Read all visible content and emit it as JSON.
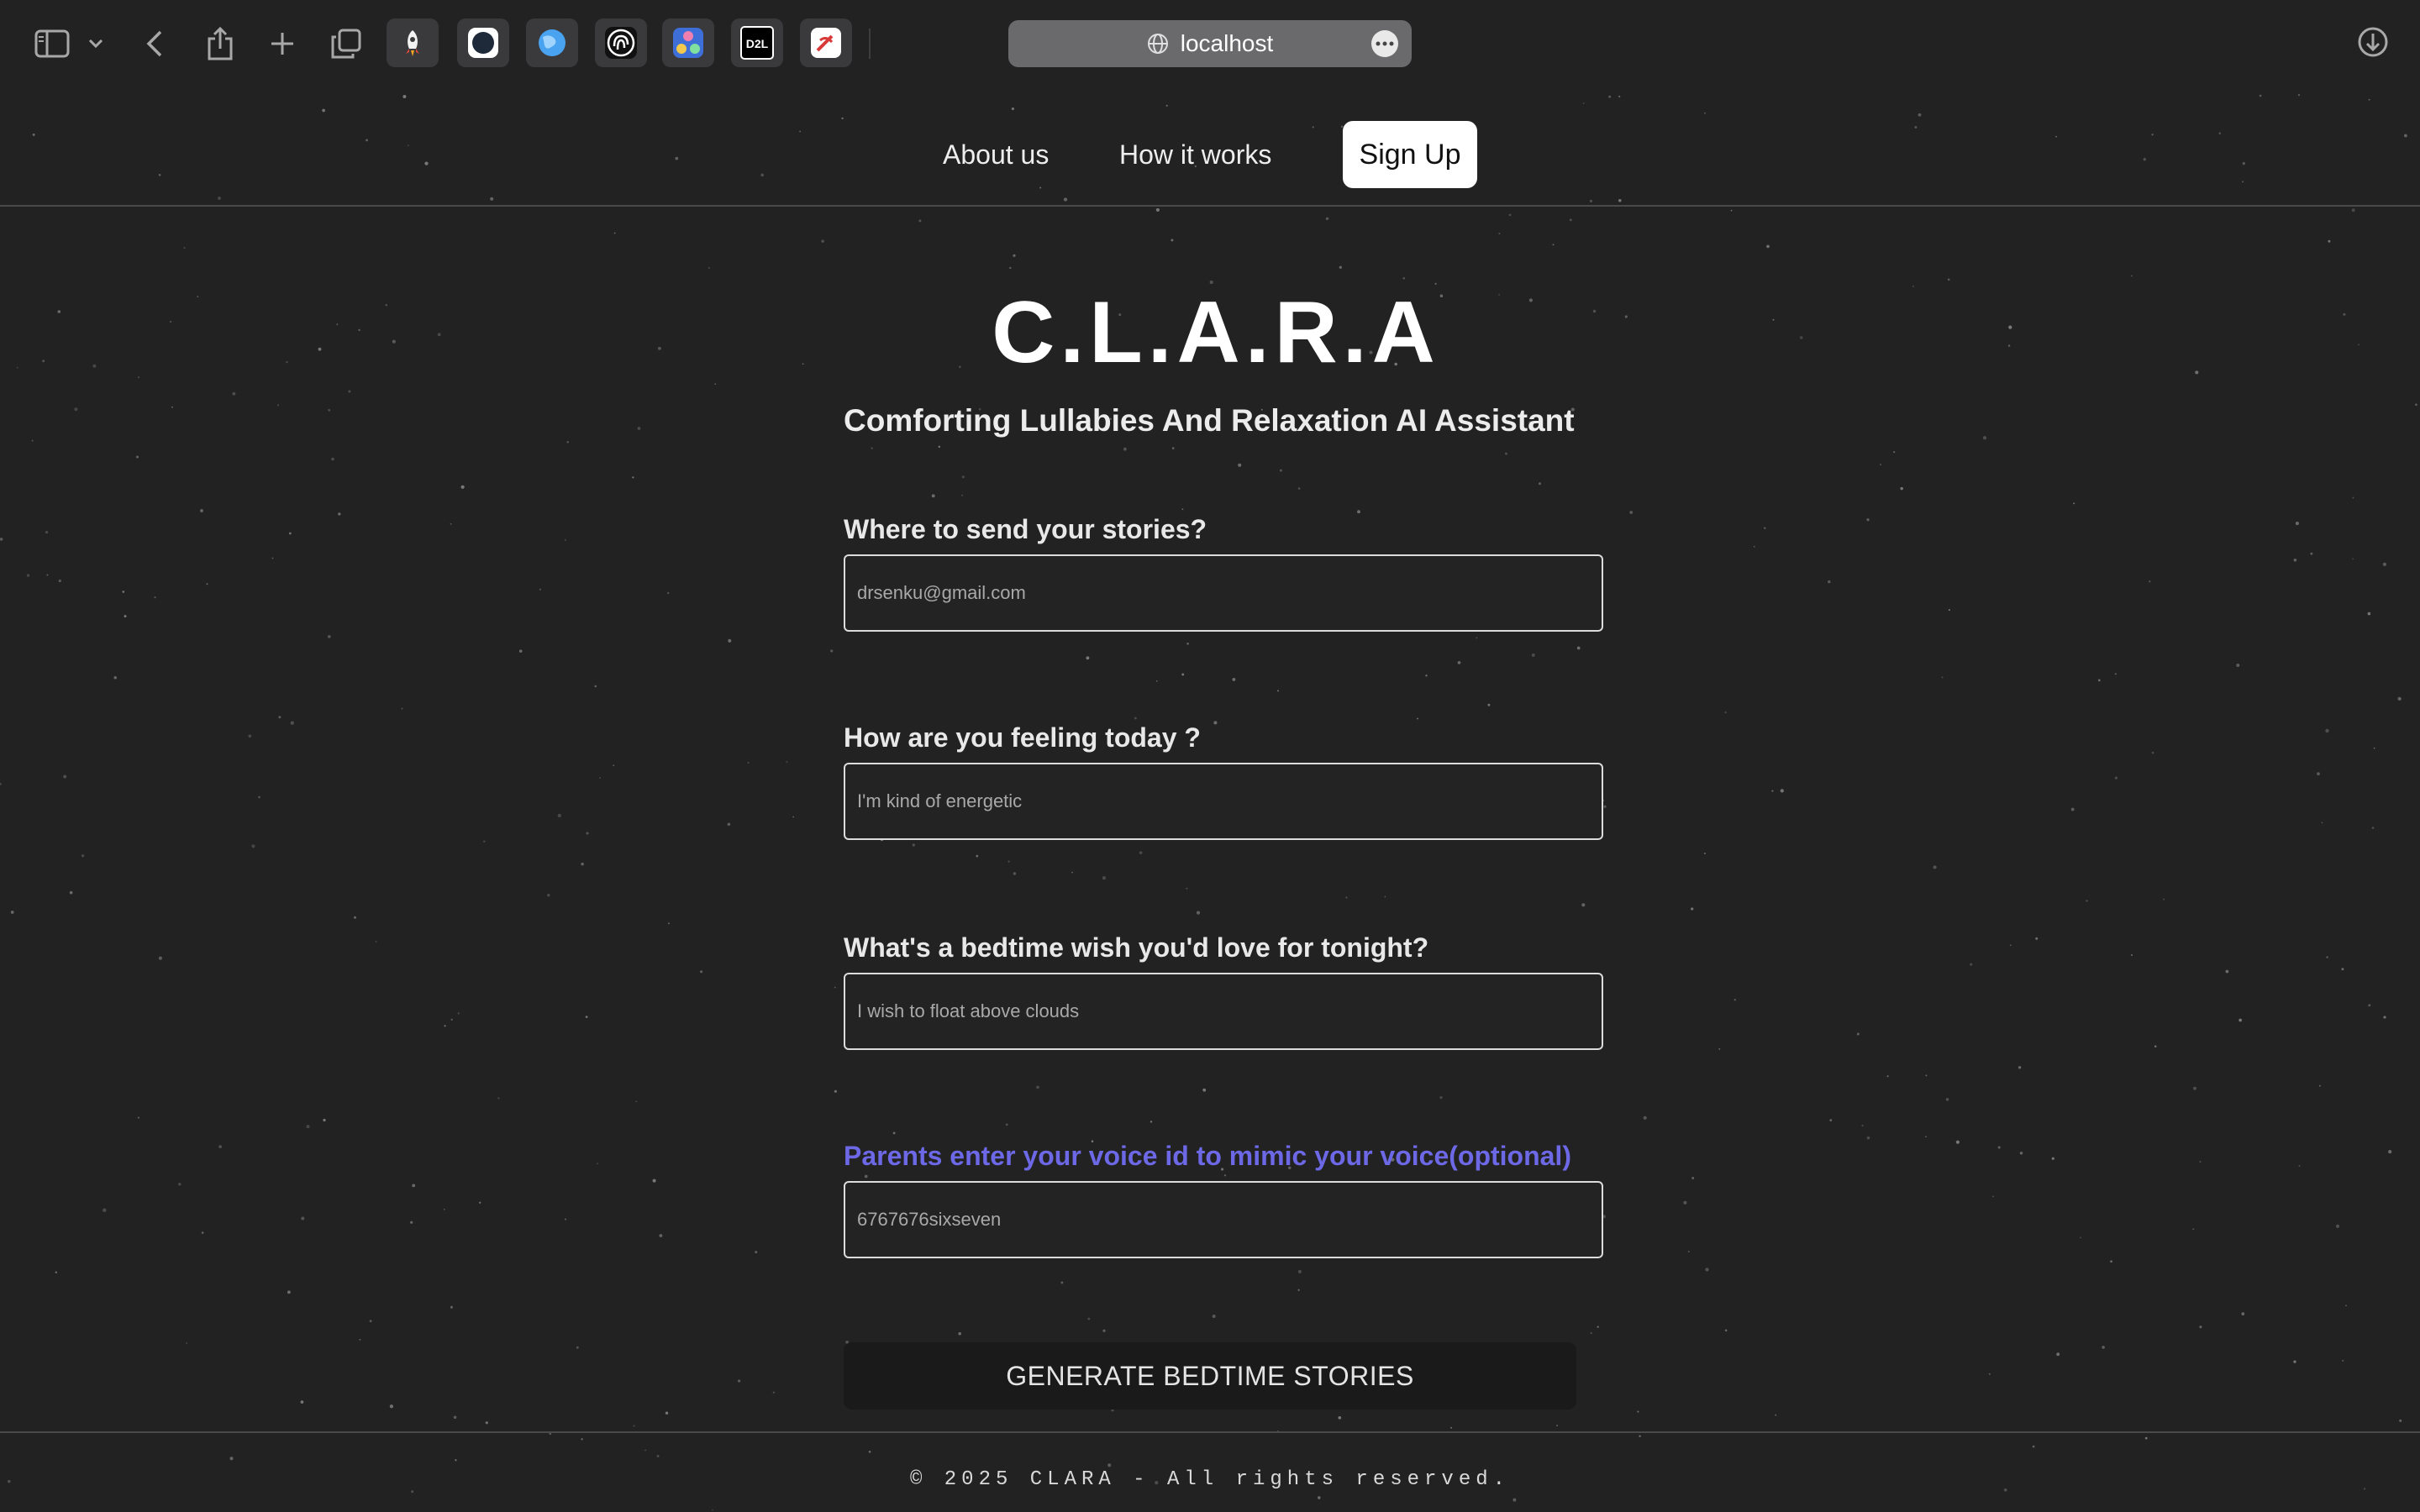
{
  "browser": {
    "url": "localhost",
    "icons": {
      "sidebar": "sidebar-icon",
      "chevron": "chevron-down-icon",
      "back": "back-icon",
      "share": "share-icon",
      "new_tab": "plus-icon",
      "tabs": "tabs-overview-icon",
      "globe": "globe-icon",
      "more": "more-icon",
      "downloads": "download-icon"
    },
    "extensions": [
      "rocket-icon",
      "dark-circle-icon",
      "blue-globe-icon",
      "fingerprint-icon",
      "molecule-icon",
      "d2l-icon",
      "no-edit-icon"
    ],
    "extension_labels": {
      "d2l": "D2L"
    }
  },
  "nav": {
    "about": "About us",
    "how": "How it works",
    "signup": "Sign Up"
  },
  "hero": {
    "title": "C.L.A.R.A",
    "tagline": "Comforting Lullabies And Relaxation AI Assistant"
  },
  "form": {
    "email": {
      "label": "Where to send your stories?",
      "value": "drsenku@gmail.com"
    },
    "feeling": {
      "label": "How are you feeling today ?",
      "value": "I'm kind of energetic"
    },
    "wish": {
      "label": "What's a bedtime wish you'd love for tonight?",
      "value": "I wish to float above clouds"
    },
    "voice": {
      "label": "Parents enter your voice id to mimic your voice(optional)",
      "value": "6767676sixseven"
    },
    "submit": "GENERATE BEDTIME STORIES"
  },
  "footer": {
    "text": "© 2025 CLARA - All rights reserved."
  },
  "colors": {
    "background": "#222223",
    "accent": "#6c68e6",
    "signup_bg": "#ffffff"
  }
}
